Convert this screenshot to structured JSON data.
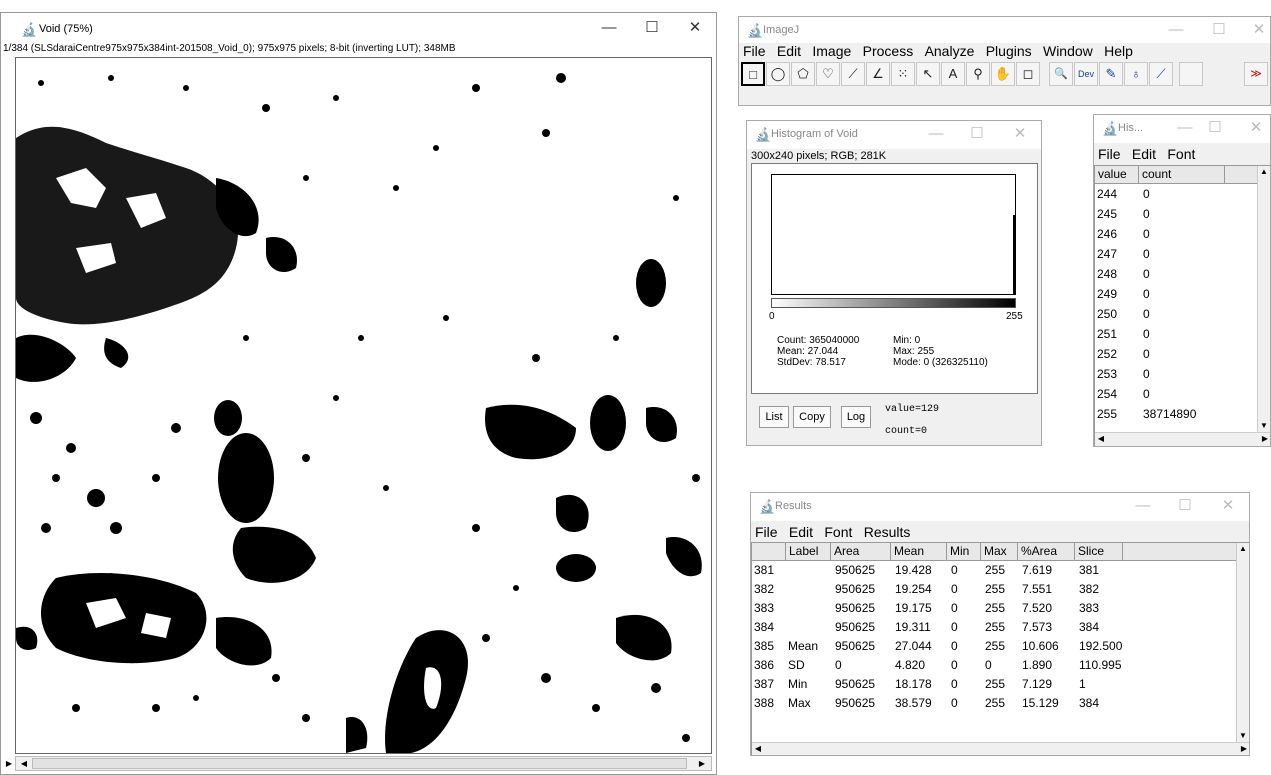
{
  "void_window": {
    "title": "Void (75%)",
    "info": "1/384 (SLSdaraiCentre975x975x384int-201508_Void_0); 975x975 pixels; 8-bit (inverting LUT); 348MB",
    "minimize": "—",
    "maximize": "☐",
    "close": "✕",
    "play_icon": "▶",
    "left_arrow": "◀",
    "right_arrow": "▶"
  },
  "imagej_window": {
    "title": "ImageJ",
    "minimize": "—",
    "maximize": "☐",
    "close": "✕",
    "menus": [
      "File",
      "Edit",
      "Image",
      "Process",
      "Analyze",
      "Plugins",
      "Window",
      "Help"
    ],
    "tools": [
      {
        "name": "rectangle-tool-icon",
        "glyph": "□"
      },
      {
        "name": "oval-tool-icon",
        "glyph": "◯"
      },
      {
        "name": "polygon-tool-icon",
        "glyph": "⬠"
      },
      {
        "name": "freehand-tool-icon",
        "glyph": "♡"
      },
      {
        "name": "line-tool-icon",
        "glyph": "⟋"
      },
      {
        "name": "angle-tool-icon",
        "glyph": "∠"
      },
      {
        "name": "point-tool-icon",
        "glyph": "⁙"
      },
      {
        "name": "wand-tool-icon",
        "glyph": "↖"
      },
      {
        "name": "text-tool-icon",
        "glyph": "A"
      },
      {
        "name": "magnifier-tool-icon",
        "glyph": "⚲"
      },
      {
        "name": "hand-tool-icon",
        "glyph": "✋"
      },
      {
        "name": "dropper-tool-icon",
        "glyph": "◻"
      },
      {
        "name": "zoom-icon",
        "glyph": "🔍"
      },
      {
        "name": "dev-menu-icon",
        "glyph": "Dev"
      },
      {
        "name": "pencil-tool-icon",
        "glyph": "✎"
      },
      {
        "name": "brush-tool-icon",
        "glyph": "♁"
      },
      {
        "name": "flood-fill-tool-icon",
        "glyph": "⟋"
      },
      {
        "name": "blank-tool-icon",
        "glyph": ""
      },
      {
        "name": "more-tools-icon",
        "glyph": "≫"
      }
    ]
  },
  "histogram_window": {
    "title": "Histogram of Void",
    "minimize": "—",
    "maximize": "☐",
    "close": "✕",
    "info": "300x240 pixels; RGB; 281K",
    "axis_min": "0",
    "axis_max": "255",
    "count": "Count: 365040000",
    "mean": "Mean: 27.044",
    "stddev": "StdDev: 78.517",
    "min": "Min: 0",
    "max": "Max: 255",
    "mode": "Mode: 0 (326325110)",
    "list_button": "List",
    "copy_button": "Copy",
    "log_button": "Log",
    "value_readout": "value=129",
    "count_readout": "count=0"
  },
  "his_table_window": {
    "title": "His...",
    "minimize": "—",
    "maximize": "☐",
    "close": "✕",
    "menus": [
      "File",
      "Edit",
      "Font"
    ],
    "columns": [
      "value",
      "count"
    ],
    "rows": [
      [
        "244",
        "0"
      ],
      [
        "245",
        "0"
      ],
      [
        "246",
        "0"
      ],
      [
        "247",
        "0"
      ],
      [
        "248",
        "0"
      ],
      [
        "249",
        "0"
      ],
      [
        "250",
        "0"
      ],
      [
        "251",
        "0"
      ],
      [
        "252",
        "0"
      ],
      [
        "253",
        "0"
      ],
      [
        "254",
        "0"
      ],
      [
        "255",
        "38714890"
      ]
    ]
  },
  "results_window": {
    "title": "Results",
    "minimize": "—",
    "maximize": "☐",
    "close": "✕",
    "menus": [
      "File",
      "Edit",
      "Font",
      "Results"
    ],
    "columns": [
      "",
      "Label",
      "Area",
      "Mean",
      "Min",
      "Max",
      "%Area",
      "Slice"
    ],
    "rows": [
      [
        "381",
        "",
        "950625",
        "19.428",
        "0",
        "255",
        "7.619",
        "381"
      ],
      [
        "382",
        "",
        "950625",
        "19.254",
        "0",
        "255",
        "7.551",
        "382"
      ],
      [
        "383",
        "",
        "950625",
        "19.175",
        "0",
        "255",
        "7.520",
        "383"
      ],
      [
        "384",
        "",
        "950625",
        "19.311",
        "0",
        "255",
        "7.573",
        "384"
      ],
      [
        "385",
        "Mean",
        "950625",
        "27.044",
        "0",
        "255",
        "10.606",
        "192.500"
      ],
      [
        "386",
        "SD",
        "0",
        "4.820",
        "0",
        "0",
        "1.890",
        "110.995"
      ],
      [
        "387",
        "Min",
        "950625",
        "18.178",
        "0",
        "255",
        "7.129",
        "1"
      ],
      [
        "388",
        "Max",
        "950625",
        "38.579",
        "0",
        "255",
        "15.129",
        "384"
      ]
    ]
  }
}
